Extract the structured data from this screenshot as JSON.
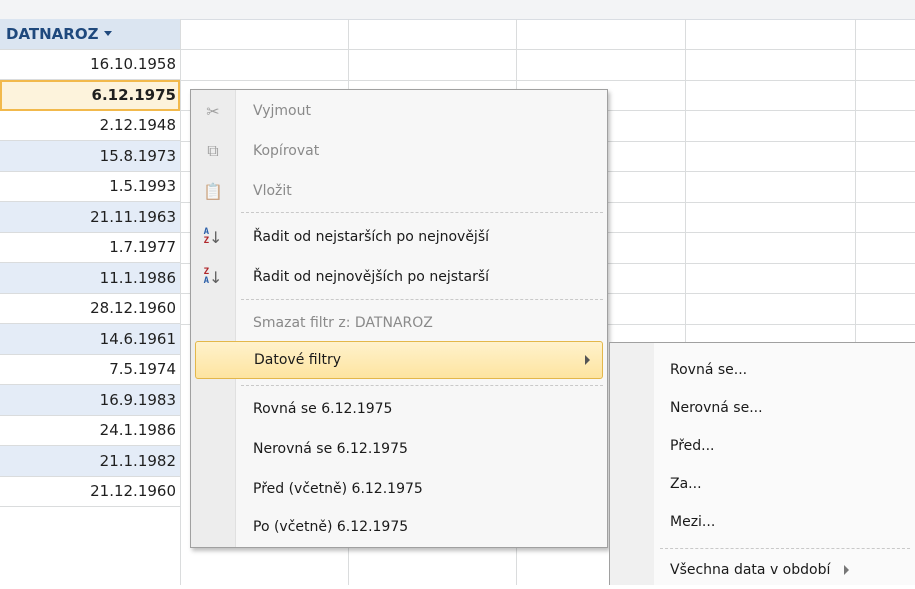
{
  "column": {
    "header": "DATNAROZ"
  },
  "cells": [
    "16.10.1958",
    "6.12.1975",
    "2.12.1948",
    "15.8.1973",
    "1.5.1993",
    "21.11.1963",
    "1.7.1977",
    "11.1.1986",
    "28.12.1960",
    "14.6.1961",
    "7.5.1974",
    "16.9.1983",
    "24.1.1986",
    "21.1.1982",
    "21.12.1960"
  ],
  "menu": {
    "cut": "Vyjmout",
    "copy": "Kopírovat",
    "paste": "Vložit",
    "sort_asc": "Řadit od nejstarších po nejnovější",
    "sort_desc": "Řadit od nejnovějších po nejstarší",
    "clear_filter": "Smazat filtr z: DATNAROZ",
    "date_filters": "Datové filtry",
    "equals": "Rovná se 6.12.1975",
    "not_equals": "Nerovná se 6.12.1975",
    "before": "Před (včetně) 6.12.1975",
    "after": "Po (včetně) 6.12.1975"
  },
  "submenu": {
    "equals": "Rovná se...",
    "not_equals": "Nerovná se...",
    "before": "Před...",
    "after": "Za...",
    "between": "Mezi...",
    "all_dates": "Všechna data v období"
  },
  "colors": {
    "header_text": "#1f497d",
    "selection_border": "#f2b94c",
    "hover_fill": "#fde4a0"
  }
}
